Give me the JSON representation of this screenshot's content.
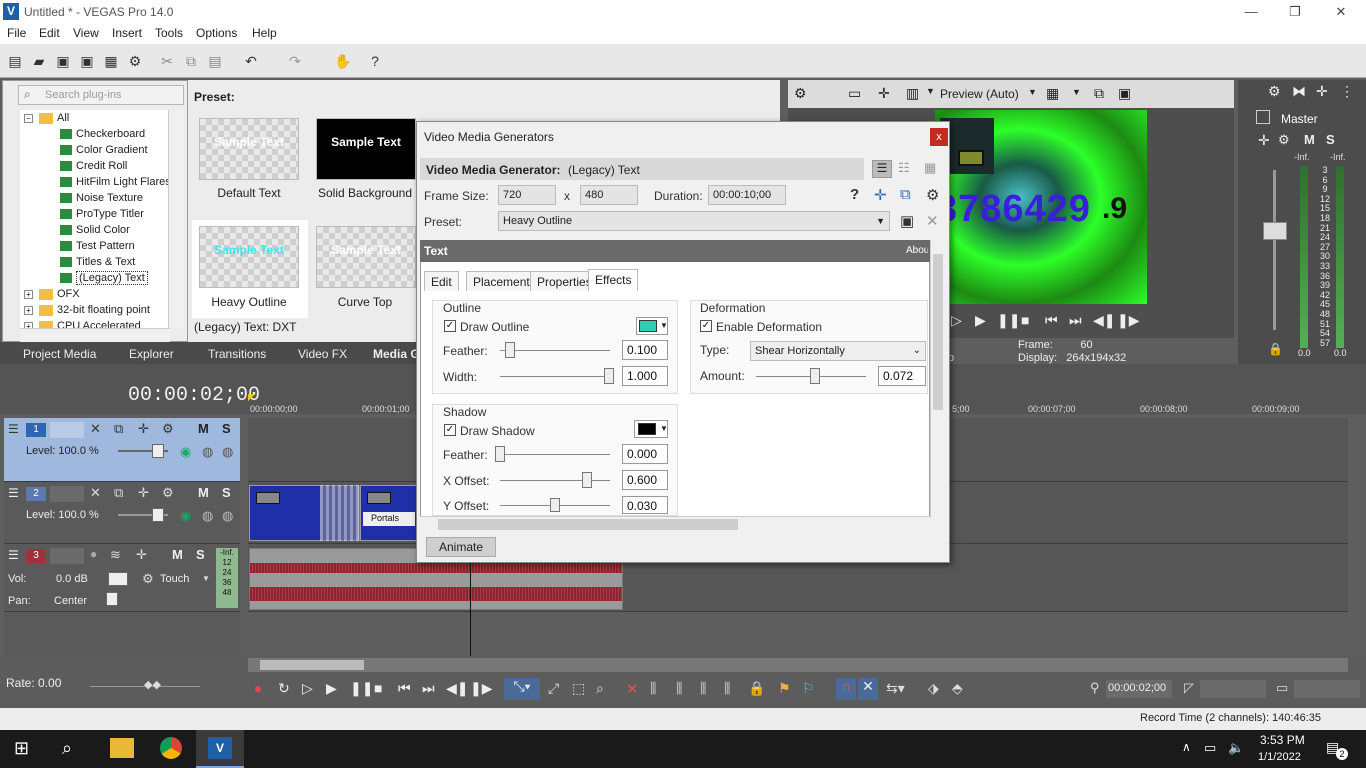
{
  "window": {
    "title": "Untitled * - VEGAS Pro 14.0",
    "minimize": "—",
    "restore": "❐",
    "close": "✕"
  },
  "menu": [
    "File",
    "Edit",
    "View",
    "Insert",
    "Tools",
    "Options",
    "Help"
  ],
  "plugins": {
    "search_placeholder": "Search plug-ins",
    "tree": [
      {
        "label": "All",
        "type": "folder",
        "expanded": true
      },
      {
        "label": "Checkerboard",
        "type": "item"
      },
      {
        "label": "Color Gradient",
        "type": "item"
      },
      {
        "label": "Credit Roll",
        "type": "item"
      },
      {
        "label": "HitFilm Light Flares",
        "type": "item"
      },
      {
        "label": "Noise Texture",
        "type": "item"
      },
      {
        "label": "ProType Titler",
        "type": "item"
      },
      {
        "label": "Solid Color",
        "type": "item"
      },
      {
        "label": "Test Pattern",
        "type": "item"
      },
      {
        "label": "Titles & Text",
        "type": "item"
      },
      {
        "label": "(Legacy) Text",
        "type": "item",
        "selected": true
      },
      {
        "label": "OFX",
        "type": "folder"
      },
      {
        "label": "32-bit floating point",
        "type": "folder"
      },
      {
        "label": "CPU Accelerated",
        "type": "folder"
      }
    ]
  },
  "presets": {
    "label": "Preset:",
    "items": [
      {
        "name": "Default Text",
        "thumb_text": "Sample Text"
      },
      {
        "name": "Solid Background",
        "thumb_text": "Sample Text"
      },
      {
        "name": "Heavy Outline",
        "thumb_text": "Sample Text",
        "selected": true
      },
      {
        "name": "Curve Top",
        "thumb_text": "Sample Text"
      }
    ],
    "status": "(Legacy) Text: DXT"
  },
  "panel_tabs": [
    "Project Media",
    "Explorer",
    "Transitions",
    "Video FX",
    "Media G"
  ],
  "preview": {
    "quality": "Preview (Auto)",
    "overlay_number": "3786429",
    "overlay_suffix": ".9",
    "frame_label": "Frame:",
    "frame_value": "60",
    "display_label": "Display:",
    "display_value": "264x194x32",
    "left_trunc": "p"
  },
  "master": {
    "label": "Master",
    "m": "M",
    "s": "S",
    "inf_left": "-Inf.",
    "inf_right": "-Inf.",
    "scale": [
      "3",
      "6",
      "9",
      "12",
      "15",
      "18",
      "21",
      "24",
      "27",
      "30",
      "33",
      "36",
      "39",
      "42",
      "45",
      "48",
      "51",
      "54",
      "57"
    ],
    "out_left": "0.0",
    "out_right": "0.0"
  },
  "timeline": {
    "timecode": "00:00:02;00",
    "ruler": [
      "00:00:00;00",
      "00:00:01;00",
      "00:00:07;00",
      "00:00:08;00",
      "00:00:09;00"
    ],
    "ruler_partial": "5;00"
  },
  "tracks": [
    {
      "num": "1",
      "level": "Level: 100.0 %",
      "m": "M",
      "s": "S"
    },
    {
      "num": "2",
      "level": "Level: 100.0 %",
      "m": "M",
      "s": "S",
      "clip_label": "Portals"
    },
    {
      "num": "3",
      "vol_label": "Vol:",
      "vol": "0.0 dB",
      "touch": "Touch",
      "pan_label": "Pan:",
      "pan": "Center",
      "m": "M",
      "s": "S",
      "meter": [
        "-Inf.",
        "12",
        "24",
        "36",
        "48"
      ]
    }
  ],
  "dialog": {
    "title": "Video Media Generators",
    "close": "x",
    "generator_label": "Video Media Generator:",
    "generator_value": "(Legacy) Text",
    "frame_size_label": "Frame Size:",
    "width": "720",
    "x": "x",
    "height": "480",
    "duration_label": "Duration:",
    "duration": "00:00:10;00",
    "preset_label": "Preset:",
    "preset_value": "Heavy Outline",
    "inner_title": "Text",
    "about": "About",
    "tabs": [
      "Edit",
      "Placement",
      "Properties",
      "Effects"
    ],
    "outline": {
      "title": "Outline",
      "draw": "Draw Outline",
      "feather_label": "Feather:",
      "feather": "0.100",
      "width_label": "Width:",
      "width": "1.000",
      "color": "#2ad0b4"
    },
    "shadow": {
      "title": "Shadow",
      "draw": "Draw Shadow",
      "feather_label": "Feather:",
      "feather": "0.000",
      "x_label": "X Offset:",
      "x": "0.600",
      "y_label": "Y Offset:",
      "y": "0.030",
      "color": "#000000"
    },
    "deformation": {
      "title": "Deformation",
      "enable": "Enable Deformation",
      "type_label": "Type:",
      "type": "Shear Horizontally",
      "amount_label": "Amount:",
      "amount": "0.072"
    },
    "animate": "Animate"
  },
  "bottom": {
    "rate": "Rate: 0.00",
    "time_field": "00:00:02;00",
    "record_time": "Record Time (2 channels): 140:46:35"
  },
  "taskbar": {
    "time": "3:53 PM",
    "date": "1/1/2022",
    "notif": "2"
  }
}
